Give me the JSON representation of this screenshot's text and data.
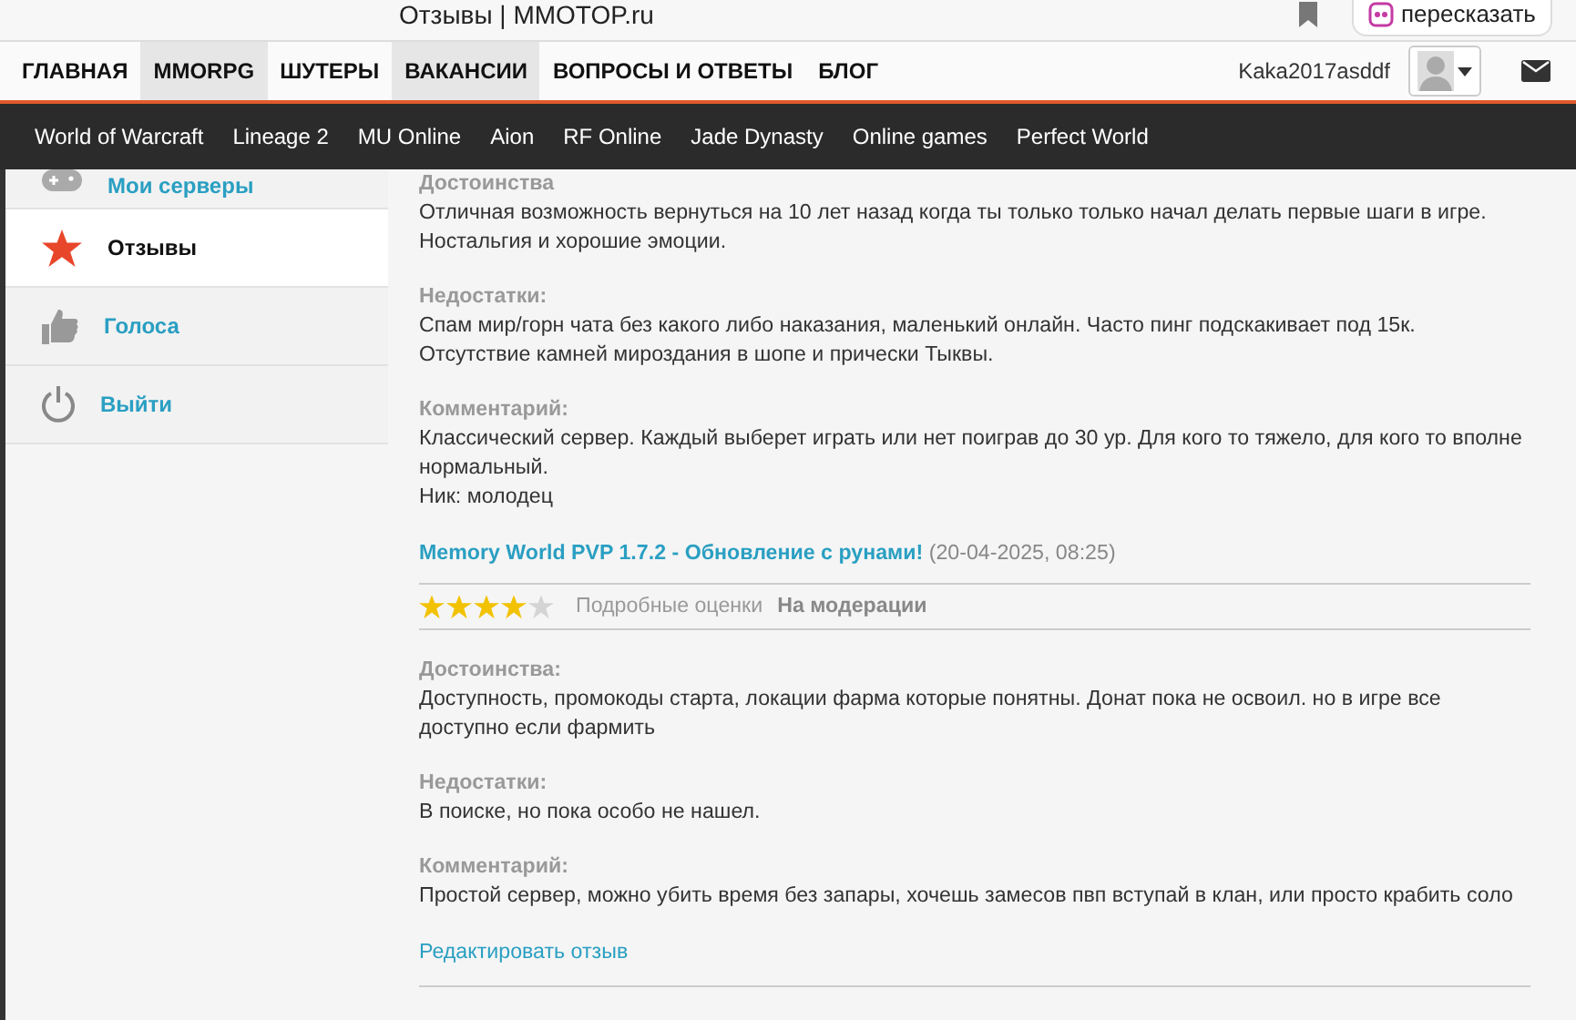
{
  "browser": {
    "title": "Отзывы | MMOTOP.ru",
    "retell_button": "пересказать"
  },
  "main_nav": [
    {
      "label": "ГЛАВНАЯ",
      "selected": false
    },
    {
      "label": "MMORPG",
      "selected": true
    },
    {
      "label": "ШУТЕРЫ",
      "selected": false
    },
    {
      "label": "ВАКАНСИИ",
      "selected": true
    },
    {
      "label": "ВОПРОСЫ И ОТВЕТЫ",
      "selected": false
    },
    {
      "label": "БЛОГ",
      "selected": false
    }
  ],
  "user": {
    "name": "Kaka2017asddf"
  },
  "games_nav": [
    "World of Warcraft",
    "Lineage 2",
    "MU Online",
    "Aion",
    "RF Online",
    "Jade Dynasty",
    "Online games",
    "Perfect World"
  ],
  "sidebar": [
    {
      "kind": "gamepad",
      "label": "Мои серверы",
      "selected": false
    },
    {
      "kind": "star",
      "label": "Отзывы",
      "selected": true
    },
    {
      "kind": "thumb",
      "label": "Голоса",
      "selected": false
    },
    {
      "kind": "power",
      "label": "Выйти",
      "selected": false
    }
  ],
  "reviews": [
    {
      "sections": [
        {
          "label": "Достоинства",
          "lines": [
            "Отличная возможность вернуться на 10 лет назад когда ты только только начал делать первые шаги в игре. Ностальгия и хорошие эмоции."
          ]
        },
        {
          "label": "Недостатки:",
          "lines": [
            "Спам мир/горн чата без какого либо наказания, маленький онлайн. Часто пинг подскакивает под 15к. Отсутствие камней мироздания в шопе и прически Тыквы."
          ]
        },
        {
          "label": "Комментарий:",
          "lines": [
            "Классический сервер. Каждый выберет играть или нет поиграв до 30 ур. Для кого то тяжело, для кого то вполне нормальный.",
            "Ник: молодец"
          ]
        }
      ]
    },
    {
      "title": "Memory World PVP 1.7.2 - Обновление с рунами!",
      "date": "(20-04-2025, 08:25)",
      "stars": 4,
      "details_link": "Подробные оценки",
      "status": "На модерации",
      "sections": [
        {
          "label": "Достоинства:",
          "lines": [
            "Доступность, промокоды старта, локации фарма которые понятны. Донат пока не освоил. но в игре все доступно если фармить"
          ]
        },
        {
          "label": "Недостатки:",
          "lines": [
            "В поиске, но пока особо не нашел."
          ]
        },
        {
          "label": "Комментарий:",
          "lines": [
            "Простой сервер, можно убить время без запары, хочешь замесов пвп вступай в клан, или просто крабить соло"
          ]
        }
      ],
      "edit_link": "Редактировать отзыв"
    }
  ]
}
